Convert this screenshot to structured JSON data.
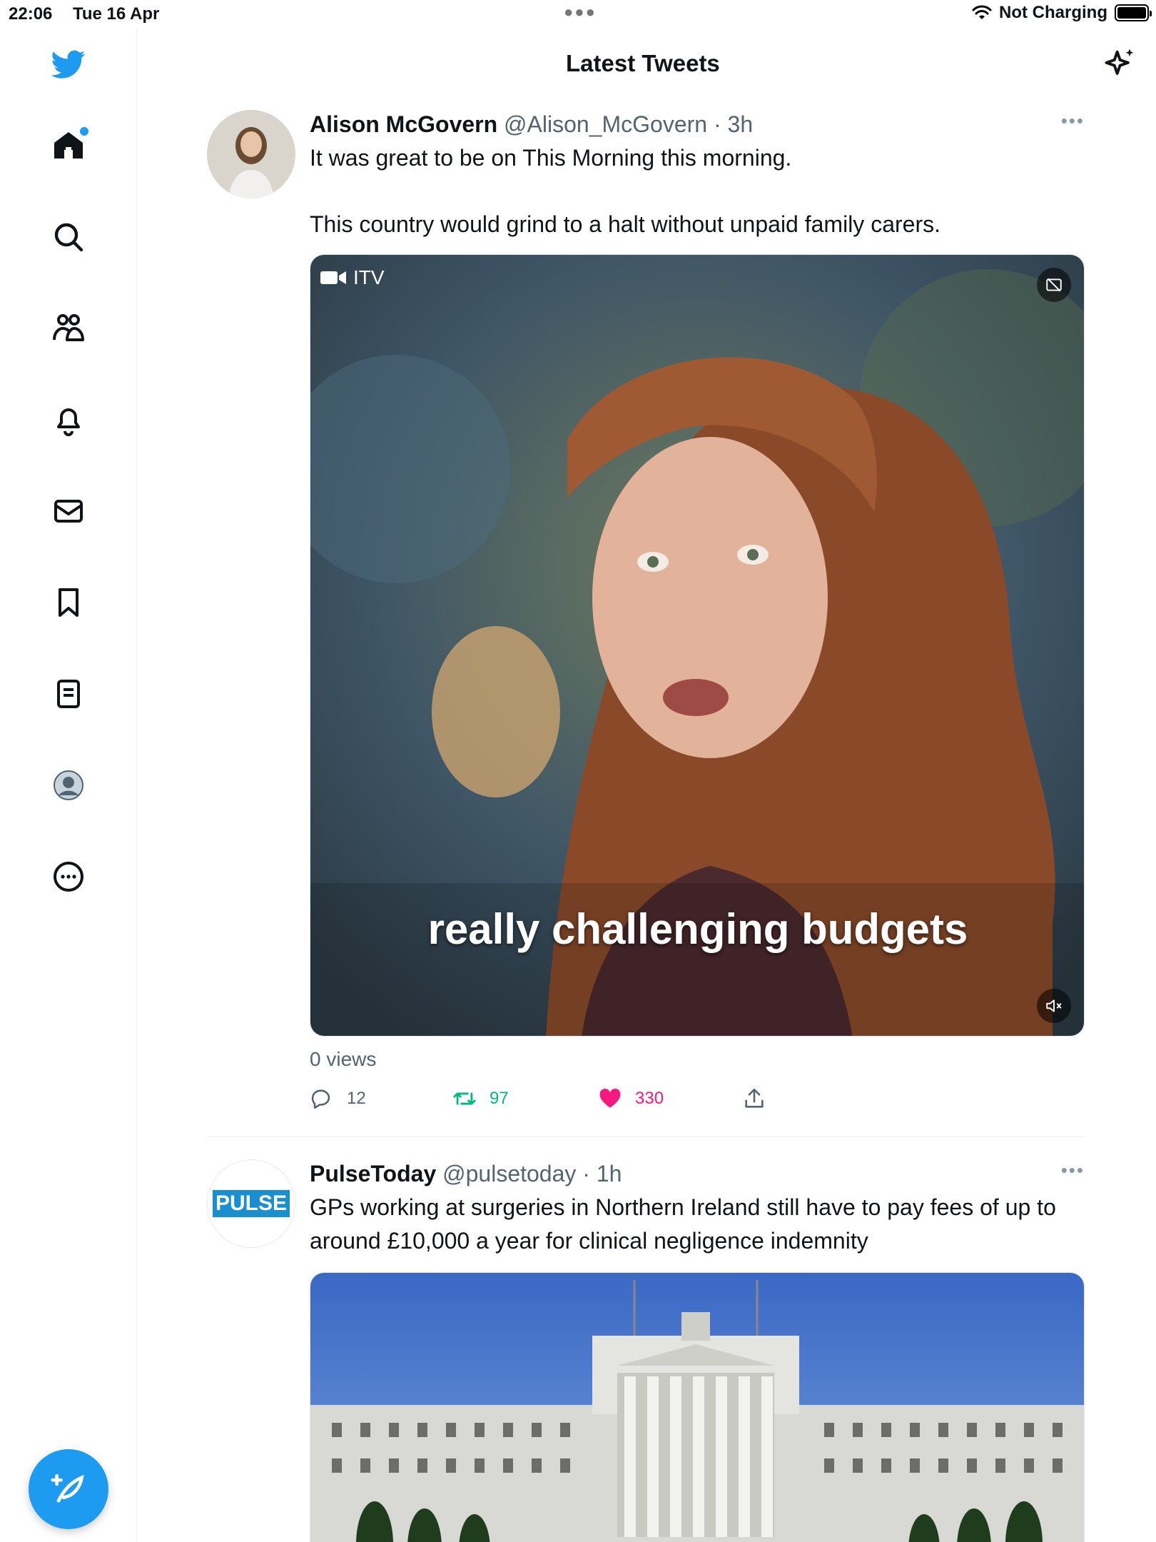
{
  "status_bar": {
    "time": "22:06",
    "date": "Tue 16 Apr",
    "network": "Not Charging"
  },
  "header": {
    "title": "Latest Tweets"
  },
  "nav": {
    "items": [
      "home",
      "search",
      "communities",
      "notifications",
      "messages",
      "bookmarks",
      "lists",
      "profile",
      "more"
    ]
  },
  "tweets": [
    {
      "name": "Alison McGovern",
      "handle": "@Alison_McGovern",
      "time": "3h",
      "text_line1": "It was great to be on This Morning this morning.",
      "text_line2": "This country would grind to a halt without unpaid family carers.",
      "video_source": "ITV",
      "caption": "really challenging budgets",
      "views": "0 views",
      "replies": "12",
      "retweets": "97",
      "likes": "330"
    },
    {
      "name": "PulseToday",
      "handle": "@pulsetoday",
      "time": "1h",
      "avatar_text": "PULSE",
      "text": "GPs working at surgeries in Northern Ireland still have to pay fees of up to around £10,000 a year for clinical negligence indemnity"
    }
  ],
  "colors": {
    "accent": "#1d9bf0",
    "like": "#f91880",
    "retweet": "#00ba7c",
    "muted": "#536471"
  }
}
